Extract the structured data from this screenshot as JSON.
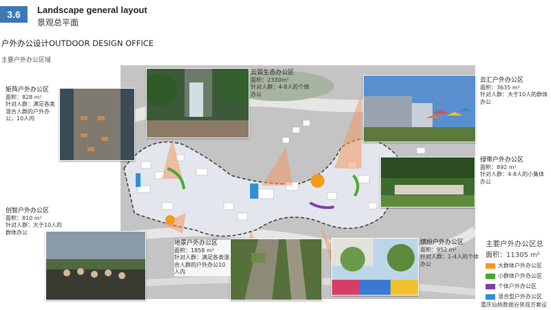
{
  "header": {
    "section_number": "3.6",
    "title_en": "Landscape general layout",
    "title_cn": "景观总平面"
  },
  "subtitle": "户外办公设计OUTDOOR DESIGN OFFICE",
  "region_label": "主要户外办公区域",
  "zones": [
    {
      "name": "矩阵户外办公区",
      "area": "面积：828 m²",
      "target": "针对人群：满足各类混合人群的户外办公，10人内"
    },
    {
      "name": "云弧生态办公区",
      "area": "面积：2330m²",
      "target": "针对人群：4-8人的个体办公"
    },
    {
      "name": "云汇户外办公区",
      "area": "面积：3635 m²",
      "target": "针对人群：大于10人的群体办公"
    },
    {
      "name": "绿带户外办公区",
      "area": "面积：892 m²",
      "target": "针对人群：4-8人的小集体办公"
    },
    {
      "name": "创智户外办公区",
      "area": "面积：810 m²",
      "target": "针对人群：大于10人的群体办公"
    },
    {
      "name": "地景户外办公区",
      "area": "面积：1858 m²",
      "target": "针对人群：满足各类混合人群的户外办公10人内"
    },
    {
      "name": "缤纷户外办公区",
      "area": "面积：952 m²",
      "target": "针对人群：1-4人的个体办公"
    }
  ],
  "legend": {
    "title": "主要户外办公区总",
    "area": "面积：11305 m²",
    "items": [
      {
        "label": "大群体户外办公区",
        "color": "#f39a1e"
      },
      {
        "label": "小群体户外办公区",
        "color": "#4aa832"
      },
      {
        "label": "个体户外办公区",
        "color": "#7a3fb0"
      },
      {
        "label": "混合型户外办公区",
        "color": "#2f8fd8"
      }
    ]
  },
  "footer": "重庆仙桃数据谷景观方案设"
}
